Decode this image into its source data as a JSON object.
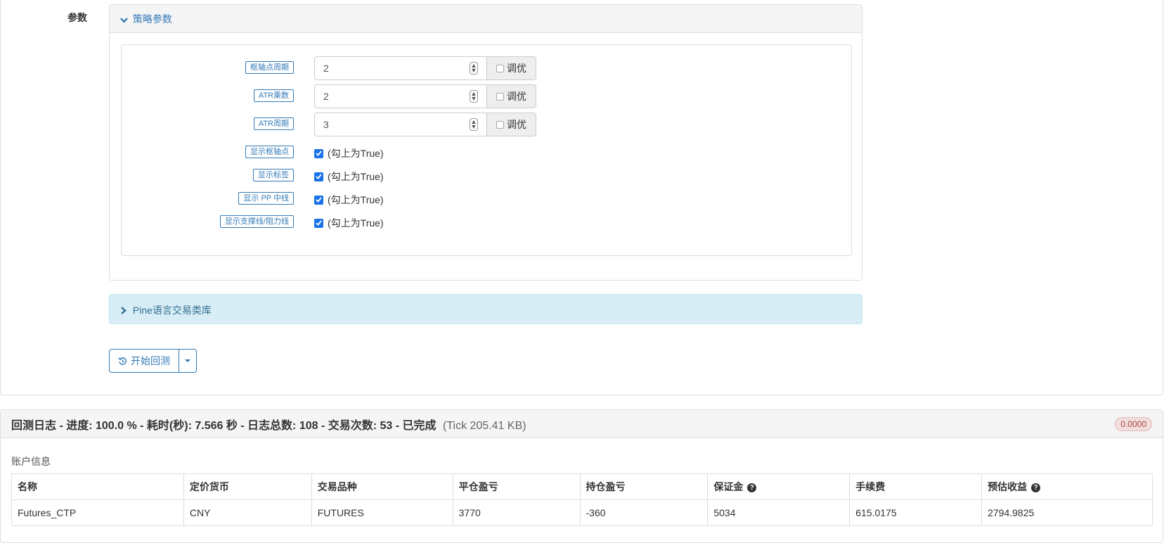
{
  "params": {
    "label": "参数",
    "strategy_panel": {
      "title": "策略参数",
      "numeric": [
        {
          "tag": "枢轴点周期",
          "value": "2",
          "optimize_label": "调优"
        },
        {
          "tag": "ATR乘数",
          "value": "2",
          "optimize_label": "调优"
        },
        {
          "tag": "ATR周期",
          "value": "3",
          "optimize_label": "调优"
        }
      ],
      "booleans": [
        {
          "tag": "显示枢轴点",
          "text": "(勾上为True)",
          "checked": true
        },
        {
          "tag": "显示标签",
          "text": "(勾上为True)",
          "checked": true
        },
        {
          "tag": "显示 PP 中线",
          "text": "(勾上为True)",
          "checked": true
        },
        {
          "tag": "显示支撑线/阻力线",
          "text": "(勾上为True)",
          "checked": true
        }
      ]
    },
    "library_panel": {
      "title": "Pine语言交易类库"
    },
    "start_button": {
      "label": "开始回测"
    }
  },
  "log": {
    "header": "回测日志 - 进度: 100.0 % - 耗时(秒): 7.566 秒 - 日志总数: 108 - 交易次数: 53 - 已完成",
    "tick": "(Tick 205.41 KB)",
    "badge": "0.0000",
    "account_label": "账户信息",
    "columns": [
      "名称",
      "定价货币",
      "交易品种",
      "平仓盈亏",
      "持仓盈亏",
      "保证金",
      "手续费",
      "预估收益"
    ],
    "rows": [
      [
        "Futures_CTP",
        "CNY",
        "FUTURES",
        "3770",
        "-360",
        "5034",
        "615.0175",
        "2794.9825"
      ]
    ]
  },
  "colors": {
    "accent": "#337ab7",
    "info_bg": "#d9edf7",
    "badge_red": "#a94442"
  }
}
